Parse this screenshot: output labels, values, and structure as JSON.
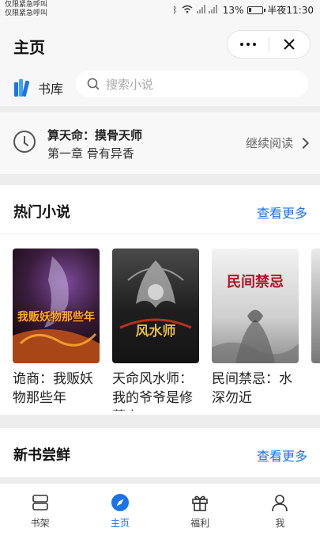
{
  "status_bar": {
    "left_line1": "仅限紧急呼叫",
    "left_line2": "仅限紧急呼叫",
    "battery": "13%",
    "time": "半夜11:30"
  },
  "header": {
    "title": "主页"
  },
  "search": {
    "shelf_label": "书库",
    "placeholder": "搜索小说"
  },
  "continue_reading": {
    "book_title": "算天命：摸骨天师",
    "chapter": "第一章 骨有异香",
    "action": "继续阅读"
  },
  "hot_section": {
    "title": "热门小说",
    "more": "查看更多",
    "books": [
      {
        "name": "诡商：我贩妖物那些年",
        "cover_text": "我贩妖物那些年",
        "cover_color": "#3a1d1a",
        "accent": "#f0a020"
      },
      {
        "name": "天命风水师：我的爷爷是修墓人",
        "cover_text": "风水师",
        "cover_color": "#2a2a2a",
        "accent": "#e8c048"
      },
      {
        "name": "民间禁忌：水深勿近",
        "cover_text": "民间禁忌",
        "cover_color": "#dcdcdc",
        "accent": "#b0142a"
      }
    ]
  },
  "new_section": {
    "title": "新书尝鲜",
    "more": "查看更多"
  },
  "tabbar": {
    "items": [
      {
        "label": "书架",
        "icon": "bookshelf-icon"
      },
      {
        "label": "主页",
        "icon": "compass-icon"
      },
      {
        "label": "福利",
        "icon": "gift-icon"
      },
      {
        "label": "我",
        "icon": "person-icon"
      }
    ],
    "active_color": "#1a73e8"
  }
}
